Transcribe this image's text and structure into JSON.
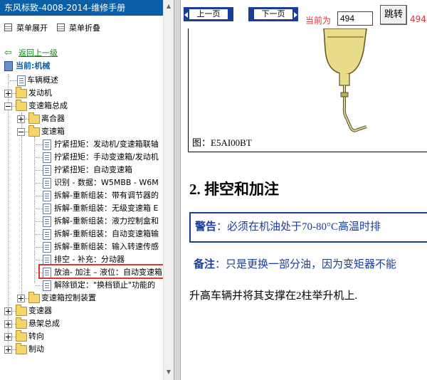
{
  "window_title": "东风标致-4008-2014-维修手册",
  "menu": {
    "expand_label": "菜单展开",
    "collapse_label": "菜单折叠"
  },
  "tree": {
    "back_label": "返回上一级",
    "current_label": "当前:机械",
    "items": [
      "车辆概述",
      "发动机",
      "变速箱总成",
      "离合器",
      "变速箱",
      "拧紧扭矩：发动机/变速箱联轴",
      "拧紧扭矩：手动变速箱/发动机",
      "拧紧扭矩：自动变速箱",
      "识别 - 数据：W5MBB - W6M",
      "拆解-重新组装：带有调节器的",
      "拆解-重新组装：无级变速箱 E",
      "拆解-重新组装：液力控制盒和",
      "拆解-重新组装：自动变速箱输",
      "拆解-重新组装：输入转速传感",
      "排空 - 补充：分动器",
      "放油- 加注 – 液位：自动变速箱",
      "解除锁定：\"换档锁止\"功能的",
      "变速箱控制装置",
      "变速器",
      "悬架总成",
      "转向",
      "制动"
    ]
  },
  "nav": {
    "prev_label": "上一页",
    "next_label": "下一页",
    "current_page_label": "当前为",
    "current_page_value": "494",
    "jump_label": "跳转",
    "total_pages": "494"
  },
  "content": {
    "figure_caption": "图：E5AI00BT",
    "section_title": "2. 排空和加注",
    "warning_label": "警告",
    "warning_text": "：必须在机油处于70-80°C高温时排",
    "note_label": "备注",
    "note_text": "：只是更换一部分油，因为变矩器不能",
    "paragraph": "升高车辆并将其支撑在2柱举升机上."
  },
  "colors": {
    "title_bar": "#0b5fa6",
    "highlight": "#e23333",
    "accent_blue": "#1a3d9a",
    "link_green": "#0a8a0a"
  }
}
